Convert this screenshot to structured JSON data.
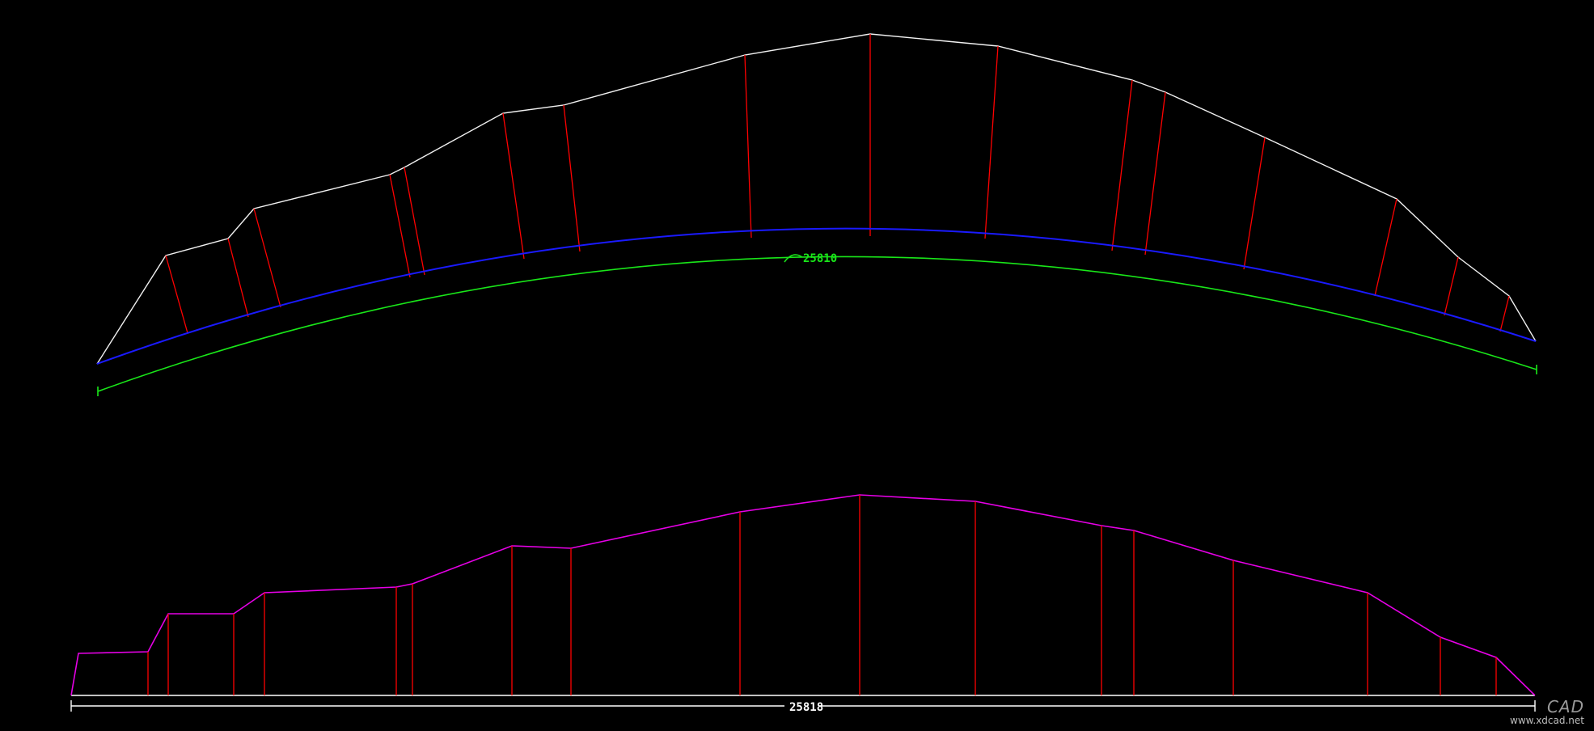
{
  "drawing": {
    "background": "#000000",
    "colors": {
      "outline": "#f0f0f0",
      "ticks": "#ff0000",
      "blue_arc": "#1a1aff",
      "green_arc": "#19e619",
      "profile": "#e600e6",
      "dim_line": "#ffffff"
    }
  },
  "top_view": {
    "arc_length_label": "25810"
  },
  "bottom_view": {
    "length_label": "25818"
  },
  "watermark": {
    "brand": "CAD",
    "url": "www.xdcad.net"
  }
}
